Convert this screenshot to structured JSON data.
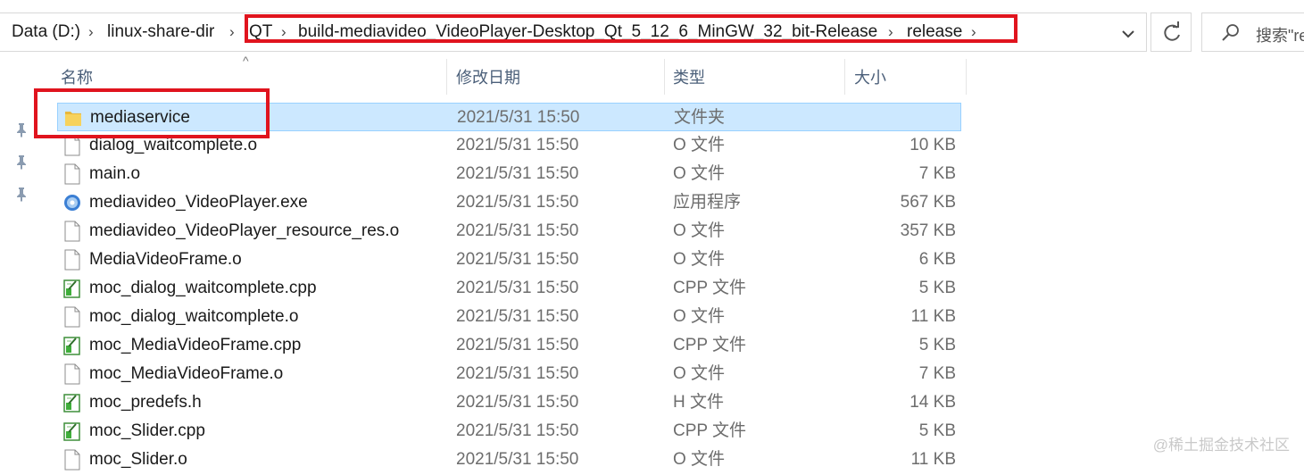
{
  "address": {
    "crumbs": [
      "Data (D:)",
      "linux-share-dir",
      "QT",
      "build-mediavideo_VideoPlayer-Desktop_Qt_5_12_6_MinGW_32_bit-Release",
      "release"
    ]
  },
  "search": {
    "placeholder": "搜索\"re"
  },
  "columns": {
    "name": "名称",
    "date": "修改日期",
    "type": "类型",
    "size": "大小"
  },
  "files": [
    {
      "name": "mediaservice",
      "date": "2021/5/31 15:50",
      "type": "文件夹",
      "size": "",
      "icon": "folder-icon",
      "selected": true
    },
    {
      "name": "dialog_waitcomplete.o",
      "date": "2021/5/31 15:50",
      "type": "O 文件",
      "size": "10 KB",
      "icon": "file-icon"
    },
    {
      "name": "main.o",
      "date": "2021/5/31 15:50",
      "type": "O 文件",
      "size": "7 KB",
      "icon": "file-icon"
    },
    {
      "name": "mediavideo_VideoPlayer.exe",
      "date": "2021/5/31 15:50",
      "type": "应用程序",
      "size": "567 KB",
      "icon": "exe-icon"
    },
    {
      "name": "mediavideo_VideoPlayer_resource_res.o",
      "date": "2021/5/31 15:50",
      "type": "O 文件",
      "size": "357 KB",
      "icon": "file-icon"
    },
    {
      "name": "MediaVideoFrame.o",
      "date": "2021/5/31 15:50",
      "type": "O 文件",
      "size": "6 KB",
      "icon": "file-icon"
    },
    {
      "name": "moc_dialog_waitcomplete.cpp",
      "date": "2021/5/31 15:50",
      "type": "CPP 文件",
      "size": "5 KB",
      "icon": "code-file-icon"
    },
    {
      "name": "moc_dialog_waitcomplete.o",
      "date": "2021/5/31 15:50",
      "type": "O 文件",
      "size": "11 KB",
      "icon": "file-icon"
    },
    {
      "name": "moc_MediaVideoFrame.cpp",
      "date": "2021/5/31 15:50",
      "type": "CPP 文件",
      "size": "5 KB",
      "icon": "code-file-icon"
    },
    {
      "name": "moc_MediaVideoFrame.o",
      "date": "2021/5/31 15:50",
      "type": "O 文件",
      "size": "7 KB",
      "icon": "file-icon"
    },
    {
      "name": "moc_predefs.h",
      "date": "2021/5/31 15:50",
      "type": "H 文件",
      "size": "14 KB",
      "icon": "code-file-icon"
    },
    {
      "name": "moc_Slider.cpp",
      "date": "2021/5/31 15:50",
      "type": "CPP 文件",
      "size": "5 KB",
      "icon": "code-file-icon"
    },
    {
      "name": "moc_Slider.o",
      "date": "2021/5/31 15:50",
      "type": "O 文件",
      "size": "11 KB",
      "icon": "file-icon"
    }
  ],
  "watermark": "@稀土掘金技术社区",
  "colors": {
    "selection": "#cce8ff",
    "highlight_box": "#e0141e"
  }
}
